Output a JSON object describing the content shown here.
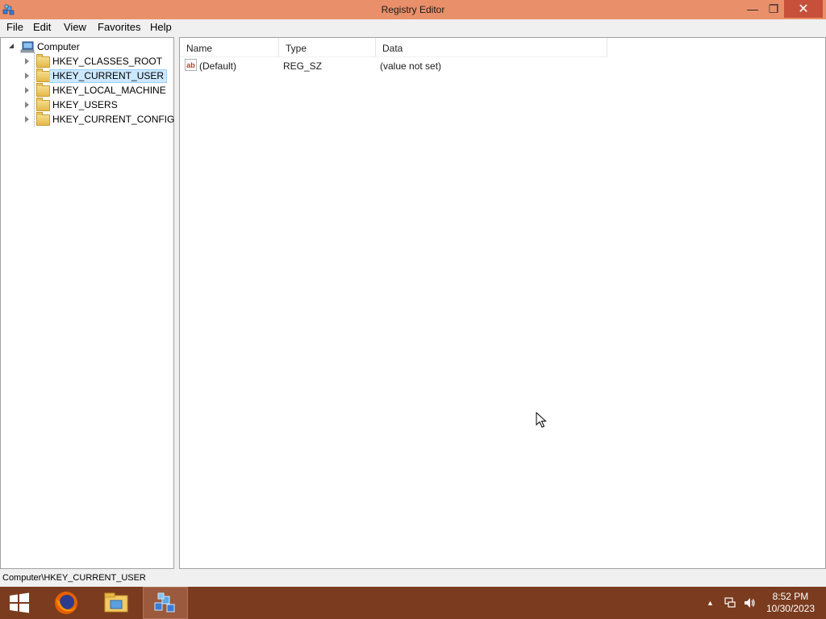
{
  "window": {
    "title": "Registry Editor",
    "controls": {
      "minimize": "—",
      "maximize": "❐",
      "close": "✕"
    }
  },
  "menu": [
    "File",
    "Edit",
    "View",
    "Favorites",
    "Help"
  ],
  "tree": {
    "root": "Computer",
    "keys": [
      {
        "label": "HKEY_CLASSES_ROOT",
        "selected": false
      },
      {
        "label": "HKEY_CURRENT_USER",
        "selected": true
      },
      {
        "label": "HKEY_LOCAL_MACHINE",
        "selected": false
      },
      {
        "label": "HKEY_USERS",
        "selected": false
      },
      {
        "label": "HKEY_CURRENT_CONFIG",
        "selected": false
      }
    ]
  },
  "list": {
    "columns": [
      "Name",
      "Type",
      "Data"
    ],
    "rows": [
      {
        "name": "(Default)",
        "type": "REG_SZ",
        "data": "(value not set)",
        "icon": "string-value-icon"
      }
    ]
  },
  "status": {
    "path": "Computer\\HKEY_CURRENT_USER"
  },
  "taskbar": {
    "apps": [
      {
        "name": "start",
        "icon": "windows-logo-icon"
      },
      {
        "name": "firefox",
        "icon": "firefox-icon"
      },
      {
        "name": "file-explorer",
        "icon": "folder-icon"
      },
      {
        "name": "registry-editor",
        "icon": "regedit-icon",
        "active": true
      }
    ],
    "clock": {
      "time": "8:52 PM",
      "date": "10/30/2023"
    }
  },
  "colors": {
    "titlebar": "#e9906a",
    "close_button": "#c7503a",
    "taskbar": "#7a3b1e",
    "selection": "#cce8ff"
  }
}
